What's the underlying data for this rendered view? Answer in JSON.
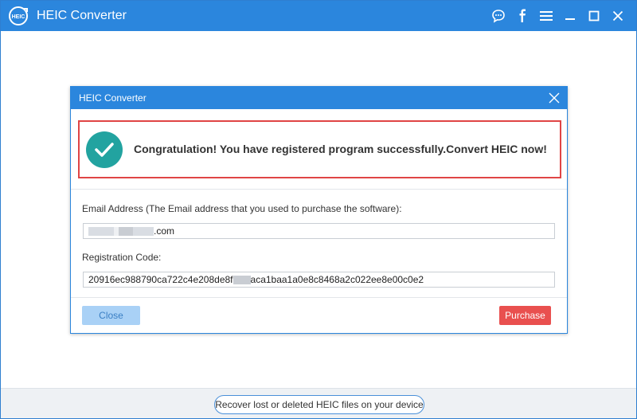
{
  "app": {
    "title": "HEIC Converter",
    "logo_text": "HEIC",
    "accent_color": "#2b86dd"
  },
  "titlebar_icons": [
    "chat-icon",
    "facebook-icon",
    "menu-icon",
    "minimize-icon",
    "maximize-icon",
    "close-icon"
  ],
  "dialog": {
    "title": "HEIC Converter",
    "success_message": "Congratulation! You have registered program successfully.Convert HEIC now!",
    "email_label": "Email Address (The Email address that you used to purchase the software):",
    "email_value_suffix": ".com",
    "code_label": "Registration Code:",
    "code_value_prefix": "20916ec988790ca722c4e208de8f",
    "code_value_suffix": "aca1baa1a0e8c8468a2c022ee8e00c0e2",
    "close_label": "Close",
    "purchase_label": "Purchase",
    "highlight_color": "#e04545",
    "success_color": "#22a3a0",
    "purchase_color": "#e9504f"
  },
  "bottom": {
    "recover_label": "Recover lost or deleted HEIC files on your device"
  }
}
